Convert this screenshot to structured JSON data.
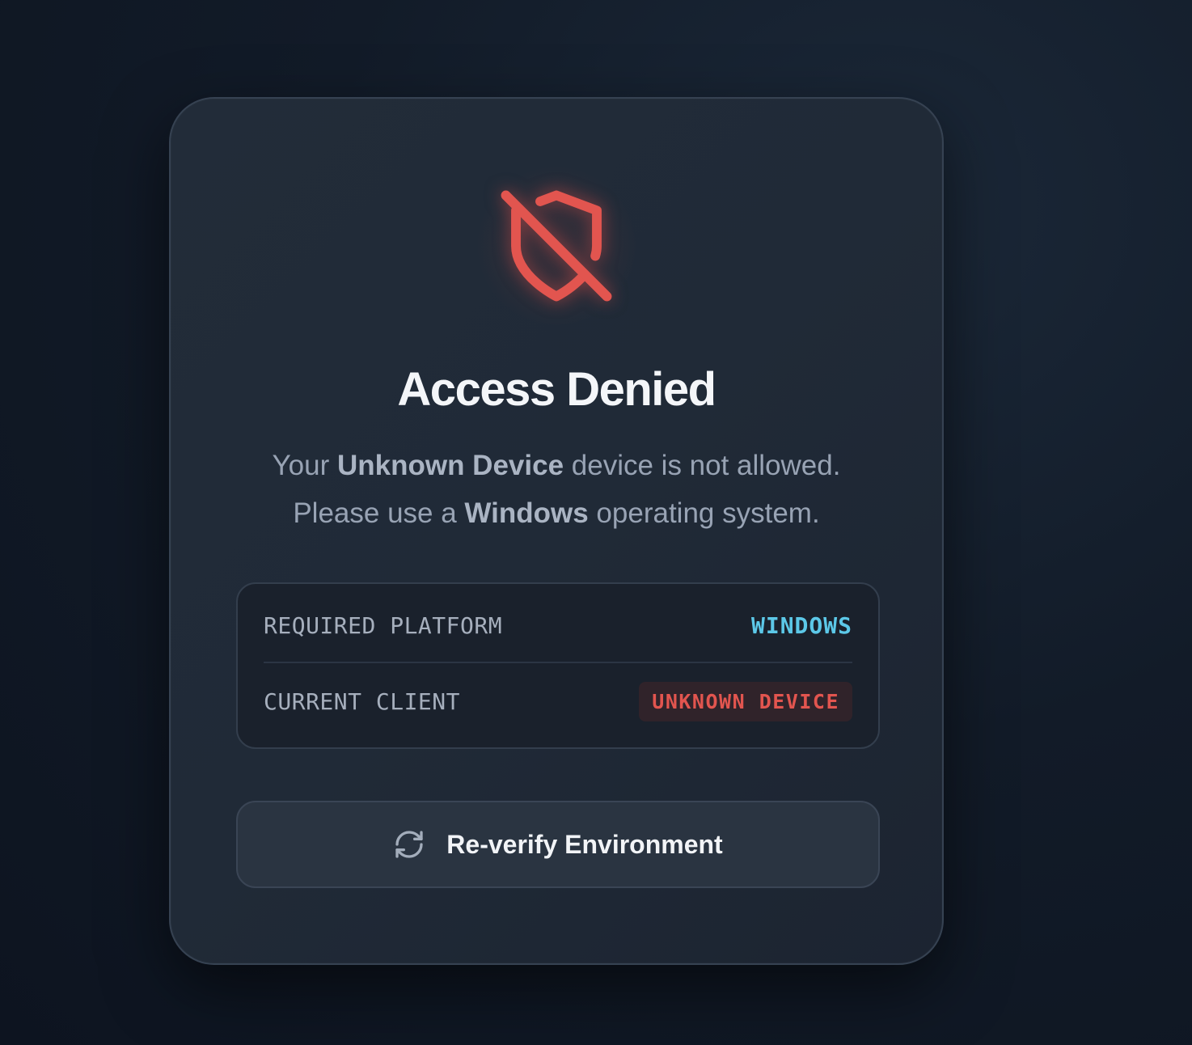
{
  "colors": {
    "accent_danger": "#e2554f",
    "accent_info": "#5cc8e8",
    "card_bg": "#212b38",
    "page_bg": "#111a26"
  },
  "icons": {
    "status": "shield-off-icon",
    "button": "refresh-icon"
  },
  "card": {
    "title": "Access Denied",
    "message": {
      "line1_prefix": "Your ",
      "line1_device": "Unknown Device",
      "line1_suffix": " device is not allowed.",
      "line2_prefix": "Please use a ",
      "line2_os": "Windows",
      "line2_suffix": " operating system."
    },
    "info": {
      "required_label": "REQUIRED PLATFORM",
      "required_value": "WINDOWS",
      "current_label": "CURRENT CLIENT",
      "current_value": "UNKNOWN DEVICE"
    },
    "button_label": "Re-verify Environment"
  }
}
